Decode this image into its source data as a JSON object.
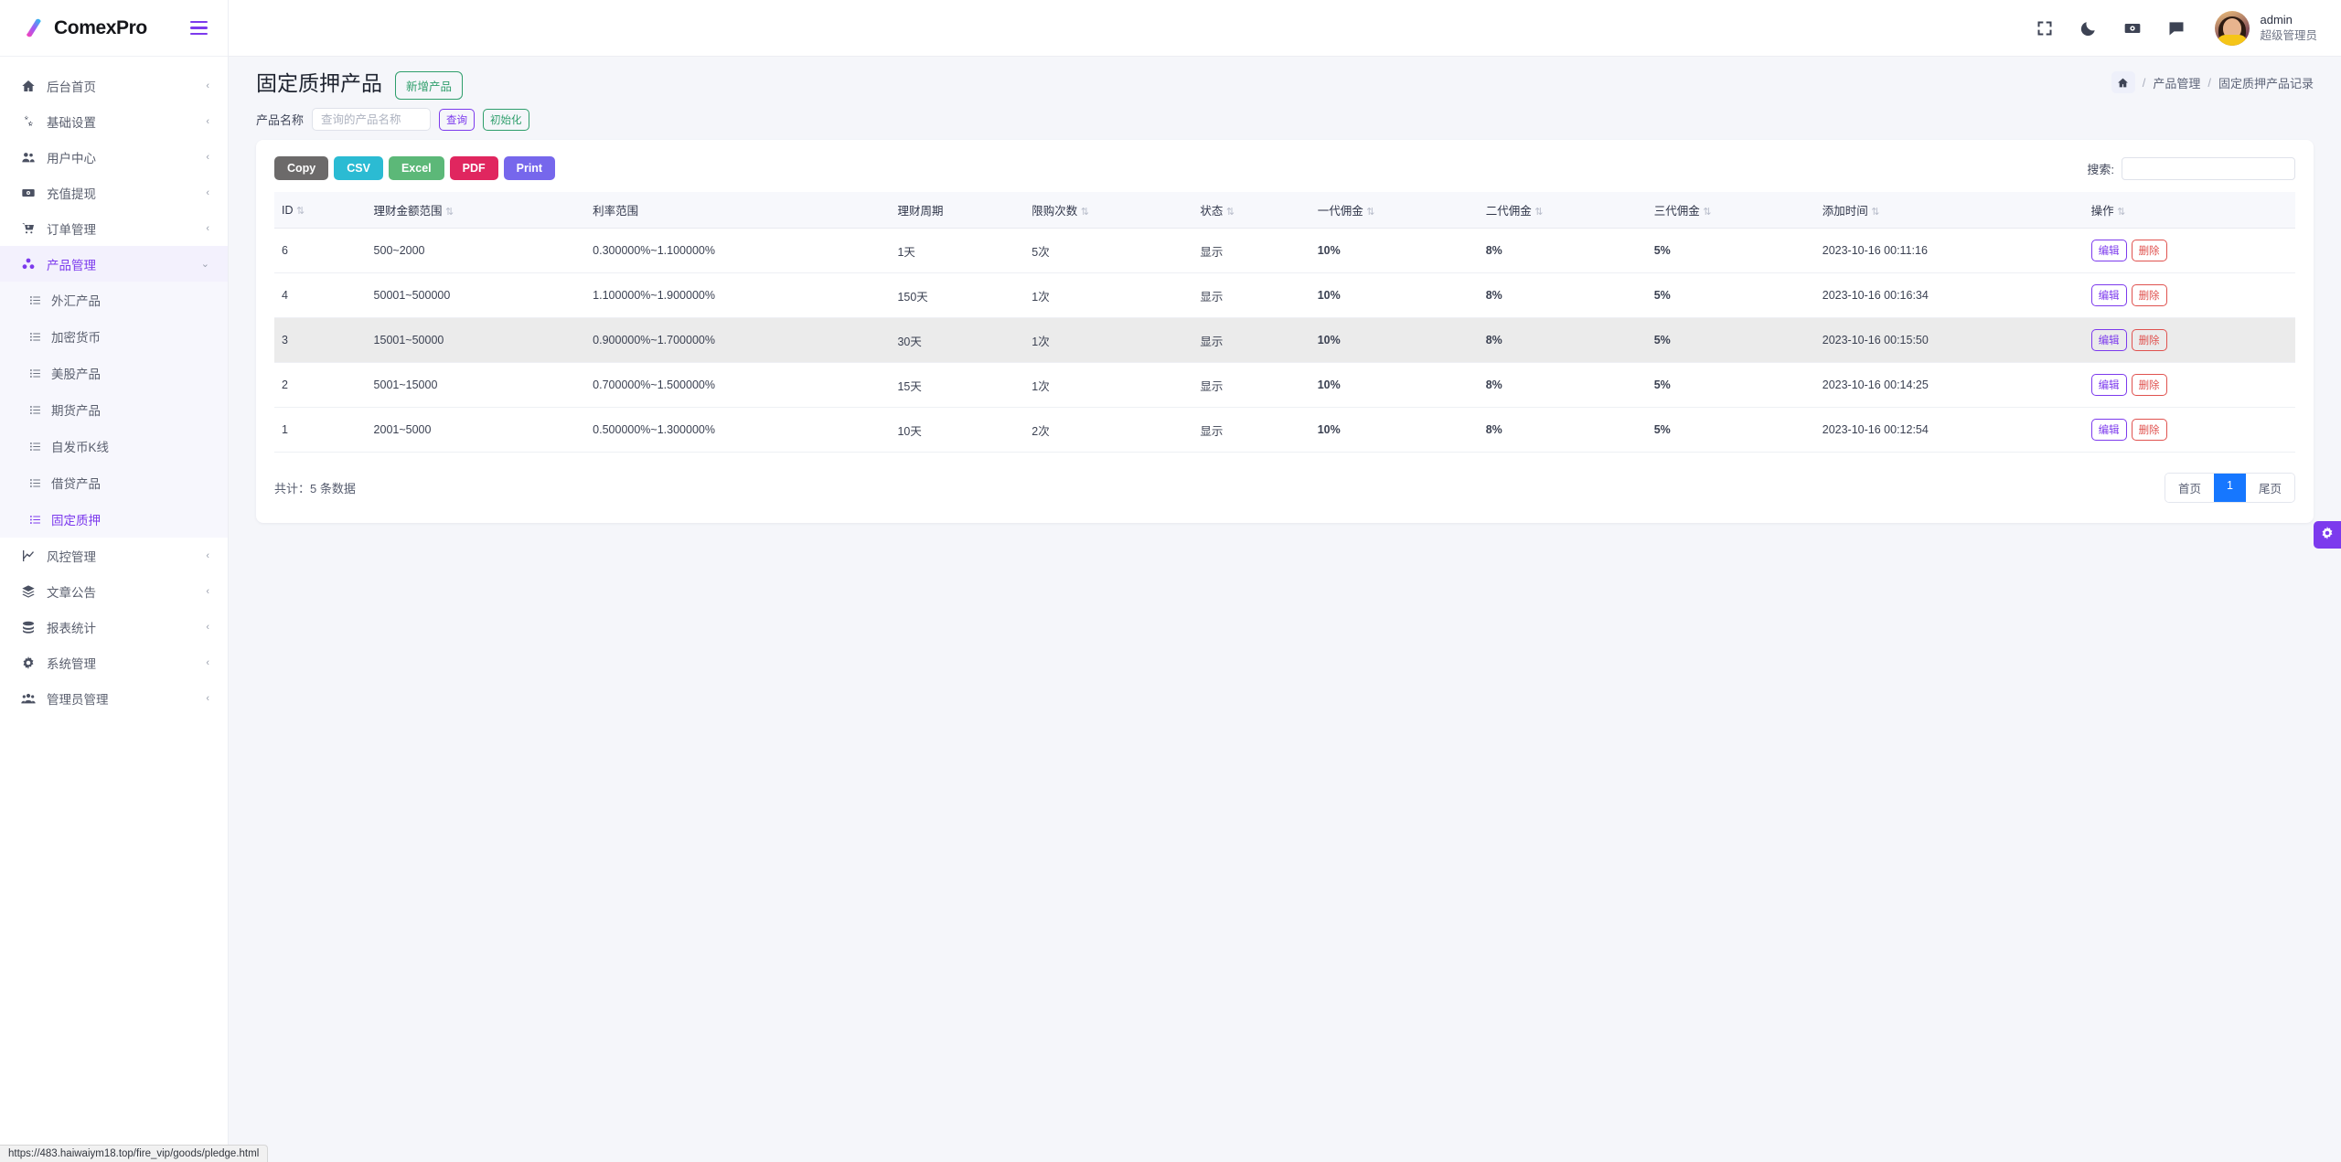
{
  "brand": {
    "name": "ComexPro"
  },
  "sidebar": {
    "items": [
      {
        "label": "后台首页",
        "icon": "home-icon",
        "caret": "‹"
      },
      {
        "label": "基础设置",
        "icon": "gears-icon",
        "caret": "‹"
      },
      {
        "label": "用户中心",
        "icon": "users-icon",
        "caret": "‹"
      },
      {
        "label": "充值提现",
        "icon": "money-icon",
        "caret": "‹"
      },
      {
        "label": "订单管理",
        "icon": "cart-icon",
        "caret": "‹"
      },
      {
        "label": "产品管理",
        "icon": "cubes-icon",
        "caret": "⌄",
        "active": true
      }
    ],
    "submenu": [
      {
        "label": "外汇产品",
        "icon": "list-icon"
      },
      {
        "label": "加密货币",
        "icon": "list-icon"
      },
      {
        "label": "美股产品",
        "icon": "list-icon"
      },
      {
        "label": "期货产品",
        "icon": "list-icon"
      },
      {
        "label": "自发币K线",
        "icon": "list-icon"
      },
      {
        "label": "借贷产品",
        "icon": "list-icon"
      },
      {
        "label": "固定质押",
        "icon": "list-icon",
        "active": true
      }
    ],
    "items_bottom": [
      {
        "label": "风控管理",
        "icon": "chart-line-icon",
        "caret": "‹"
      },
      {
        "label": "文章公告",
        "icon": "layers-icon",
        "caret": "‹"
      },
      {
        "label": "报表统计",
        "icon": "coins-icon",
        "caret": "‹"
      },
      {
        "label": "系统管理",
        "icon": "gear-icon",
        "caret": "‹"
      },
      {
        "label": "管理员管理",
        "icon": "user-group-icon",
        "caret": "‹"
      }
    ]
  },
  "topbar": {
    "icons": [
      "fullscreen-icon",
      "moon-icon",
      "money-bill-icon",
      "comment-icon"
    ],
    "user_name": "admin",
    "user_role": "超级管理员"
  },
  "page": {
    "title": "固定质押产品",
    "add_button": "新增产品",
    "breadcrumb": {
      "home": "home-icon",
      "sep": "/",
      "parent": "产品管理",
      "current": "固定质押产品记录"
    }
  },
  "filter": {
    "label": "产品名称",
    "placeholder": "查询的产品名称",
    "query_button": "查询",
    "reset_button": "初始化"
  },
  "toolbar": {
    "exports": [
      {
        "label": "Copy",
        "color": "#6c6a6a"
      },
      {
        "label": "CSV",
        "color": "#2bbbd3"
      },
      {
        "label": "Excel",
        "color": "#5cb878"
      },
      {
        "label": "PDF",
        "color": "#e0265f"
      },
      {
        "label": "Print",
        "color": "#7667ec"
      }
    ],
    "search_label": "搜索:",
    "search_value": ""
  },
  "table": {
    "columns": [
      {
        "label": "ID",
        "sortable": true
      },
      {
        "label": "理财金额范围",
        "sortable": true
      },
      {
        "label": "利率范围",
        "sortable": false
      },
      {
        "label": "理财周期",
        "sortable": false
      },
      {
        "label": "限购次数",
        "sortable": false
      },
      {
        "label": "状态",
        "sortable": true
      },
      {
        "label": "一代佣金",
        "sortable": true
      },
      {
        "label": "二代佣金",
        "sortable": true
      },
      {
        "label": "三代佣金",
        "sortable": true
      },
      {
        "label": "添加时间",
        "sortable": true
      },
      {
        "label": "操作",
        "sortable": true
      }
    ],
    "rows": [
      {
        "id": "6",
        "amount_range": "500~2000",
        "rate_range": "0.300000%~1.100000%",
        "period": "1天",
        "limit": "5次",
        "status": "显示",
        "c1": "10%",
        "c2": "8%",
        "c3": "5%",
        "created": "2023-10-16 00:11:16",
        "edit": "编辑",
        "del": "删除",
        "highlight": false
      },
      {
        "id": "4",
        "amount_range": "50001~500000",
        "rate_range": "1.100000%~1.900000%",
        "period": "150天",
        "limit": "1次",
        "status": "显示",
        "c1": "10%",
        "c2": "8%",
        "c3": "5%",
        "created": "2023-10-16 00:16:34",
        "edit": "编辑",
        "del": "删除",
        "highlight": false
      },
      {
        "id": "3",
        "amount_range": "15001~50000",
        "rate_range": "0.900000%~1.700000%",
        "period": "30天",
        "limit": "1次",
        "status": "显示",
        "c1": "10%",
        "c2": "8%",
        "c3": "5%",
        "created": "2023-10-16 00:15:50",
        "edit": "编辑",
        "del": "删除",
        "highlight": true
      },
      {
        "id": "2",
        "amount_range": "5001~15000",
        "rate_range": "0.700000%~1.500000%",
        "period": "15天",
        "limit": "1次",
        "status": "显示",
        "c1": "10%",
        "c2": "8%",
        "c3": "5%",
        "created": "2023-10-16 00:14:25",
        "edit": "编辑",
        "del": "删除",
        "highlight": false
      },
      {
        "id": "1",
        "amount_range": "2001~5000",
        "rate_range": "0.500000%~1.300000%",
        "period": "10天",
        "limit": "2次",
        "status": "显示",
        "c1": "10%",
        "c2": "8%",
        "c3": "5%",
        "created": "2023-10-16 00:12:54",
        "edit": "编辑",
        "del": "删除",
        "highlight": false
      }
    ],
    "total_text": "共计：5 条数据"
  },
  "pagination": {
    "first": "首页",
    "current": "1",
    "last": "尾页"
  },
  "fab": {
    "icon": "gear-icon"
  },
  "statusbar": {
    "url": "https://483.haiwaiym18.top/fire_vip/goods/pledge.html"
  },
  "colors": {
    "accent": "#7c3aed",
    "success": "#2e9e6b",
    "danger": "#e0524f",
    "page_active": "#1677ff"
  }
}
